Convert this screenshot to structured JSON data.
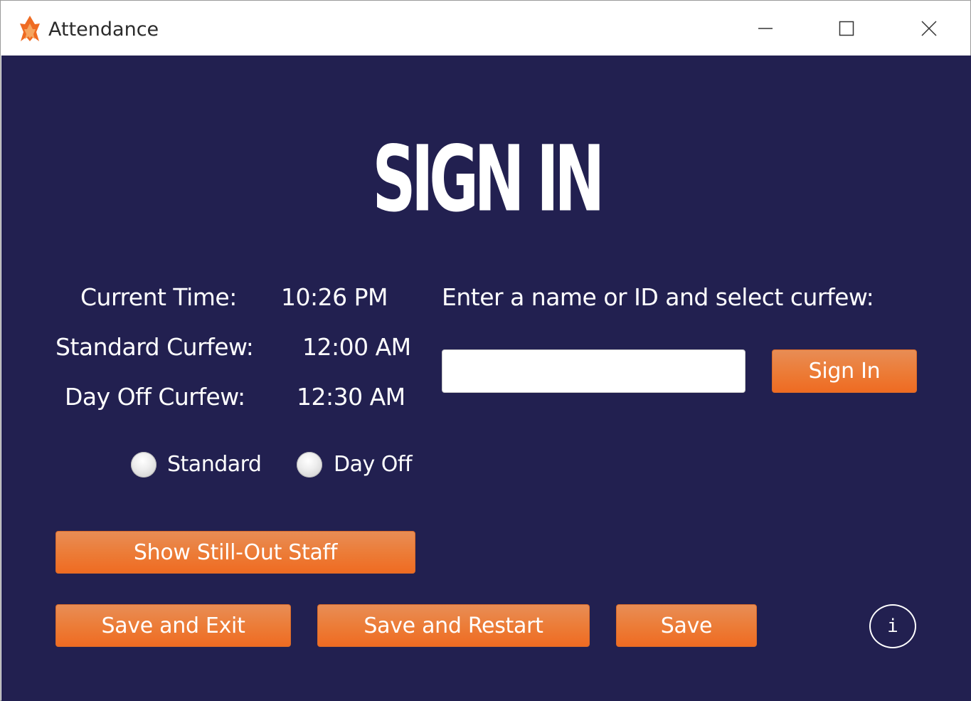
{
  "window": {
    "title": "Attendance",
    "icon": "flame-icon",
    "controls": [
      "minimize-icon",
      "maximize-icon",
      "close-icon"
    ]
  },
  "heading": "SIGN IN",
  "times": {
    "current_label": "Current Time:",
    "current_value": "10:26 PM",
    "standard_label": "Standard Curfew:",
    "standard_value": "12:00 AM",
    "dayoff_label": "Day Off Curfew:",
    "dayoff_value": "12:30 AM"
  },
  "curfew_options": {
    "standard": "Standard",
    "dayoff": "Day Off"
  },
  "sign_in": {
    "prompt": "Enter a name or ID and select curfew:",
    "input_value": "",
    "button": "Sign In"
  },
  "buttons": {
    "show_still_out": "Show Still-Out Staff",
    "save_exit": "Save and Exit",
    "save_restart": "Save and Restart",
    "save": "Save",
    "info": "i"
  },
  "colors": {
    "background": "#222050",
    "button": "#ec7b36",
    "text": "#ffffff"
  }
}
